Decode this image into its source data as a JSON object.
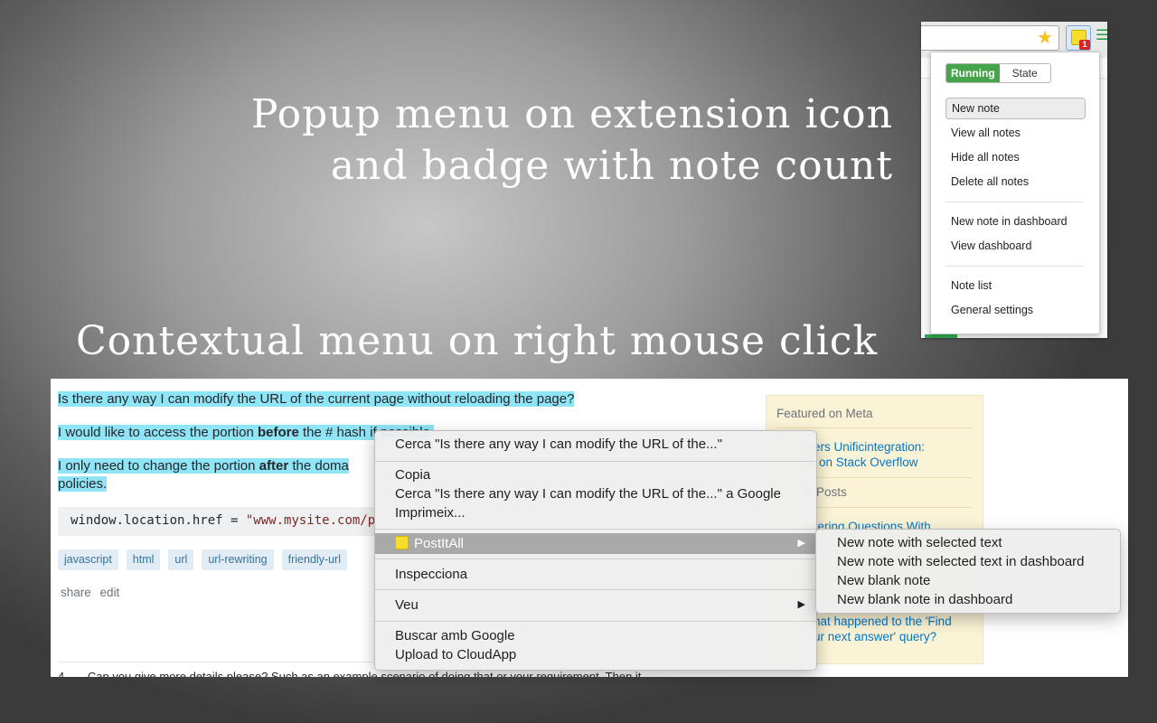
{
  "captions": {
    "popup_line1": "Popup menu on extension icon",
    "popup_line2": "and badge with note count",
    "context": "Contextual menu on right mouse click"
  },
  "browser": {
    "badge_count": "1",
    "icons": [
      "star-icon",
      "postit-extension-icon",
      "chrome-menu-icon"
    ],
    "toggle": {
      "running": "Running",
      "state": "State"
    },
    "popup_items": [
      "New note",
      "View all notes",
      "Hide all notes",
      "Delete all notes",
      "New note in dashboard",
      "View dashboard",
      "Note list",
      "General settings"
    ],
    "colors": {
      "running": "#46a54a",
      "badge": "#d5271d",
      "note_yellow": "#f7de2c"
    }
  },
  "page": {
    "question_line1": "Is there any way I can modify the URL of the current page without reloading the page?",
    "line2_pre": "I would like to access the portion ",
    "line2_bold": "before",
    "line2_post": " the # hash if possible.",
    "line3_pre": "I only need to change the portion ",
    "line3_bold": "after",
    "line3_post": " the doma",
    "line3_wrap": "policies.",
    "code_pre": "window.location.href = ",
    "code_str": "\"www.mysite.com/p",
    "tags": [
      "javascript",
      "html",
      "url",
      "url-rewriting",
      "friendly-url"
    ],
    "share": "share",
    "edit": "edit",
    "comment": "Can you give more details please? Such as an example scenario of doing that or your requirement.  Then it",
    "comment_score": "4",
    "highlight_color": "#8fe4f6"
  },
  "meta": {
    "featured_head": "Featured on Meta",
    "featured_link1": "reers Unificintegration:",
    "featured_link2": "bs on Stack Overflow",
    "hot_head": "ta Posts",
    "hot_link1": "swering Questions With",
    "bottom_link1": "hat happened to the 'Find",
    "bottom_link2": "ur next answer' query?"
  },
  "context_menu": {
    "search_selected": "Cerca \"Is there any way I can modify the URL of the...\"",
    "copy": "Copia",
    "search_google": "Cerca \"Is there any way I can modify the URL of the...\" a Google",
    "print": "Imprimeix...",
    "postitall": "PostItAll",
    "inspect": "Inspecciona",
    "speech": "Veu",
    "search_with_google": "Buscar amb Google",
    "upload_cloudapp": "Upload to CloudApp"
  },
  "submenu": {
    "items": [
      "New note with selected text",
      "New note with selected text in dashboard",
      "New blank note",
      "New blank note in dashboard"
    ]
  }
}
